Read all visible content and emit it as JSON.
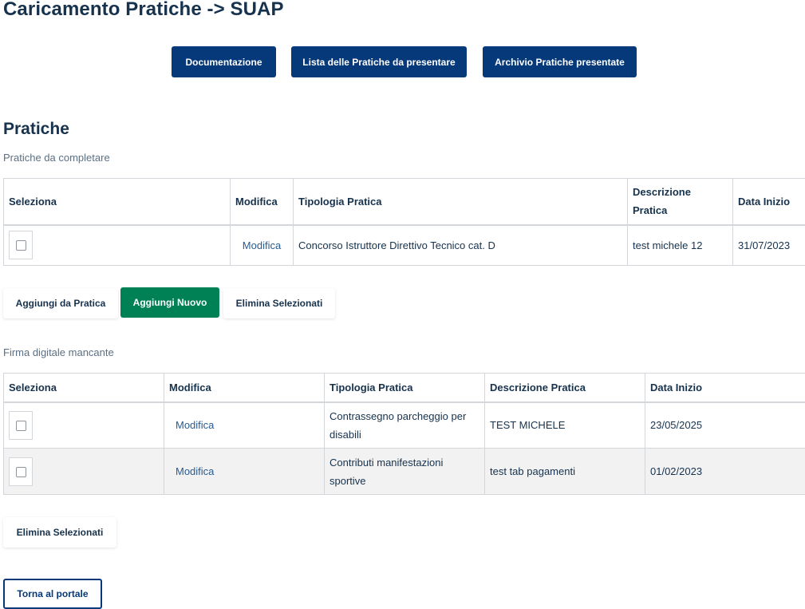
{
  "page_title": "Caricamento Pratiche -> SUAP",
  "top_buttons": {
    "documentazione": "Documentazione",
    "lista": "Lista delle Pratiche da presentare",
    "archivio": "Archivio Pratiche presentate"
  },
  "section_title": "Pratiche",
  "table1": {
    "caption": "Pratiche da completare",
    "headers": {
      "seleziona": "Seleziona",
      "modifica": "Modifica",
      "tipologia": "Tipologia Pratica",
      "descrizione": "Descrizione Pratica",
      "data": "Data Inizio"
    },
    "rows": [
      {
        "modifica": "Modifica",
        "tipologia": "Concorso Istruttore Direttivo Tecnico cat. D",
        "descrizione": "test michele 12",
        "data": "31/07/2023"
      }
    ],
    "buttons": {
      "aggiungi_da_pratica": "Aggiungi da Pratica",
      "aggiungi_nuovo": "Aggiungi Nuovo",
      "elimina_selezionati": "Elimina Selezionati"
    }
  },
  "table2": {
    "caption": "Firma digitale mancante",
    "headers": {
      "seleziona": "Seleziona",
      "modifica": "Modifica",
      "tipologia": "Tipologia Pratica",
      "descrizione": "Descrizione Pratica",
      "data": "Data Inizio"
    },
    "rows": [
      {
        "modifica": "Modifica",
        "tipologia": "Contrassegno parcheggio per disabili",
        "descrizione": "TEST MICHELE",
        "data": "23/05/2025"
      },
      {
        "modifica": "Modifica",
        "tipologia": "Contributi manifestazioni sportive",
        "descrizione": "test tab pagamenti",
        "data": "01/02/2023"
      }
    ],
    "buttons": {
      "elimina_selezionati": "Elimina Selezionati"
    }
  },
  "back_button": "Torna al portale",
  "colors": {
    "primary": "#06397a",
    "success": "#008055",
    "text": "#17324d",
    "link": "#2a5b8f"
  }
}
